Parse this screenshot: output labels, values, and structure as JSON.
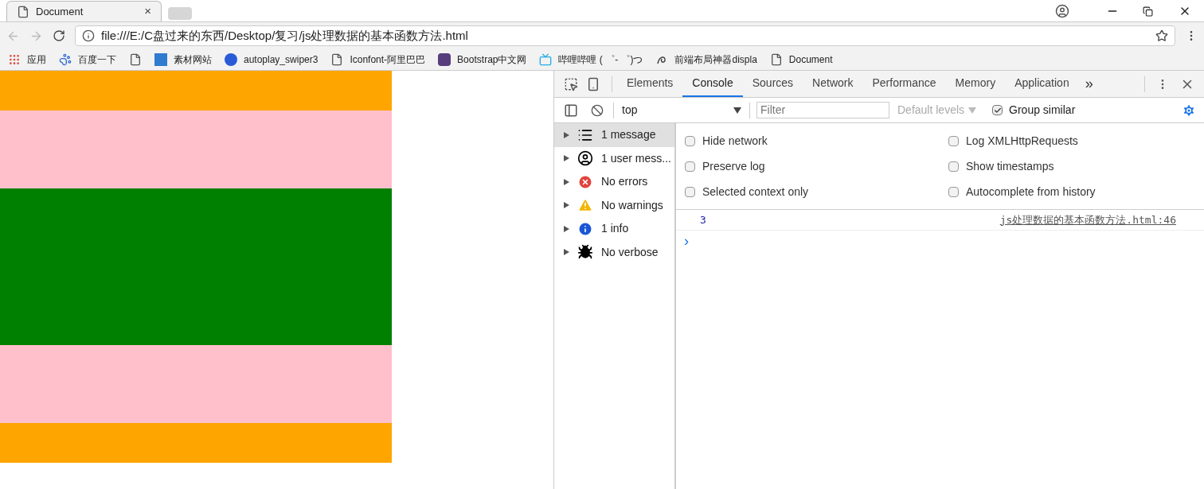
{
  "browser": {
    "tab": {
      "title": "Document",
      "close": "×"
    },
    "address": "file:///E:/C盘过来的东西/Desktop/复习/js处理数据的基本函数方法.html"
  },
  "bookmarks": [
    {
      "kind": "apps",
      "label": "应用"
    },
    {
      "kind": "paw",
      "label": "百度一下"
    },
    {
      "kind": "page"
    },
    {
      "kind": "tile",
      "label": "素材网站"
    },
    {
      "kind": "s",
      "label": "autoplay_swiper3"
    },
    {
      "kind": "page",
      "label": "Iconfont-阿里巴巴"
    },
    {
      "kind": "b",
      "label": "Bootstrap中文网"
    },
    {
      "kind": "tv",
      "label": "哔哩哔哩 ( ゜- ゜)つ"
    },
    {
      "kind": "swirl",
      "label": "前端布局神器displa"
    },
    {
      "kind": "page",
      "label": "Document"
    }
  ],
  "page_bands": [
    {
      "kind": "short",
      "color": "#ffa500"
    },
    {
      "kind": "medium",
      "color": "#ffc0cb"
    },
    {
      "kind": "tall",
      "color": "#008000"
    },
    {
      "kind": "medium",
      "color": "#ffc0cb"
    },
    {
      "kind": "short",
      "color": "#ffa500"
    }
  ],
  "devtools": {
    "tabs": [
      {
        "label": "Elements",
        "selected": false
      },
      {
        "label": "Console",
        "selected": true
      },
      {
        "label": "Sources",
        "selected": false
      },
      {
        "label": "Network",
        "selected": false
      },
      {
        "label": "Performance",
        "selected": false
      },
      {
        "label": "Memory",
        "selected": false
      },
      {
        "label": "Application",
        "selected": false
      }
    ],
    "more": "»",
    "context": "top",
    "filter_placeholder": "Filter",
    "levels": "Default levels",
    "group_similar": {
      "label": "Group similar",
      "checked": true
    },
    "sidebar": [
      {
        "kind": "list",
        "label": "1 message",
        "selected": true
      },
      {
        "kind": "user",
        "label": "1 user mess...",
        "selected": false
      },
      {
        "kind": "error",
        "label": "No errors",
        "selected": false
      },
      {
        "kind": "warning",
        "label": "No warnings",
        "selected": false
      },
      {
        "kind": "info",
        "label": "1 info",
        "selected": false
      },
      {
        "kind": "verbose",
        "label": "No verbose",
        "selected": false
      }
    ],
    "settings": [
      {
        "label": "Hide network",
        "checked": false
      },
      {
        "label": "Log XMLHttpRequests",
        "checked": false
      },
      {
        "label": "Preserve log",
        "checked": false
      },
      {
        "label": "Show timestamps",
        "checked": false
      },
      {
        "label": "Selected context only",
        "checked": false
      },
      {
        "label": "Autocomplete from history",
        "checked": false
      }
    ],
    "messages": [
      {
        "value": "3",
        "source": "js处理数据的基本函数方法.html:46"
      }
    ],
    "prompt": "›"
  }
}
